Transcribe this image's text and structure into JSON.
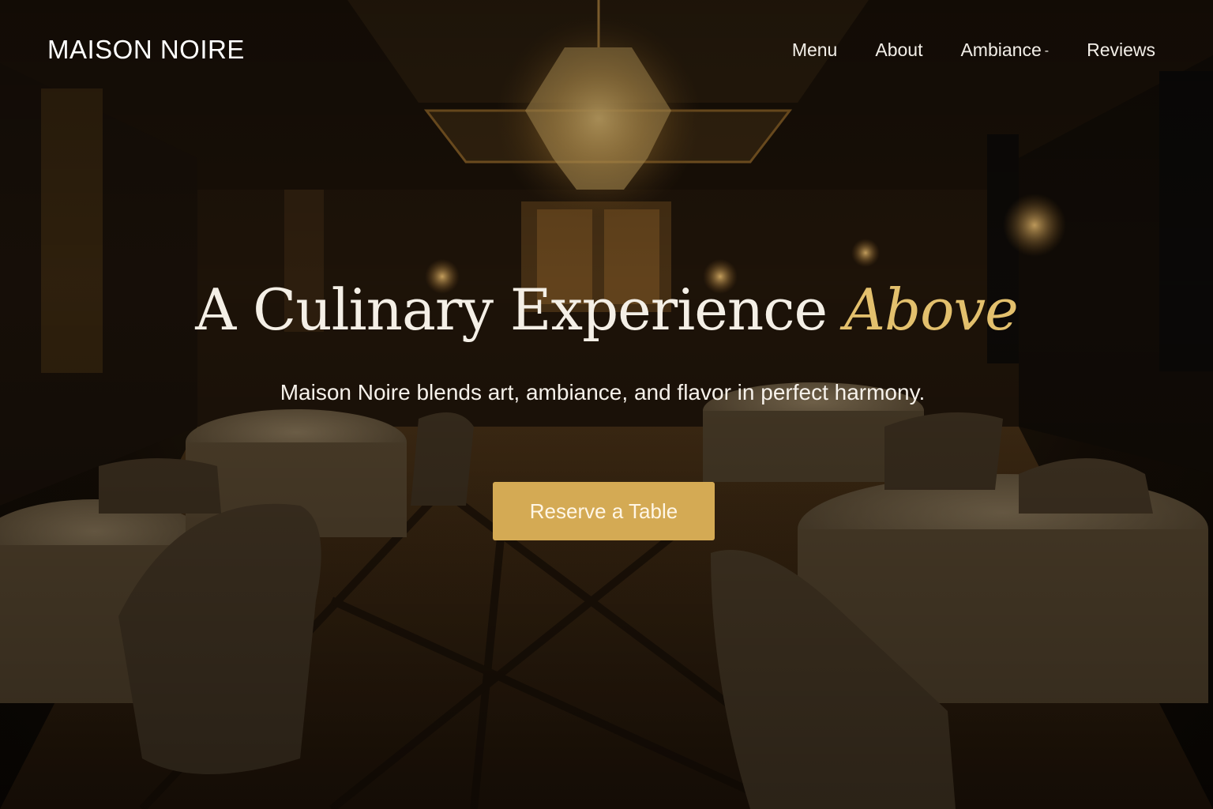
{
  "brand": {
    "name": "MAISON NOIRE"
  },
  "nav": {
    "items": [
      {
        "label": "Menu"
      },
      {
        "label": "About"
      },
      {
        "label": "Ambiance",
        "caret": "-"
      },
      {
        "label": "Reviews"
      }
    ]
  },
  "hero": {
    "headline_main": "A  Culinary Experience",
    "headline_accent": "Above",
    "tagline": "Maison Noire blends art, ambiance, and flavor in perfect harmony.",
    "cta_label": "Reserve a Table",
    "background_image": "dimly-lit fine-dining restaurant interior with crystal chandelier, round tables and upholstered chairs"
  },
  "colors": {
    "accent_gold": "#e3c06d",
    "button_gold": "#d4aa54",
    "text_light": "#f4efe6",
    "background_dark": "#170f07"
  }
}
